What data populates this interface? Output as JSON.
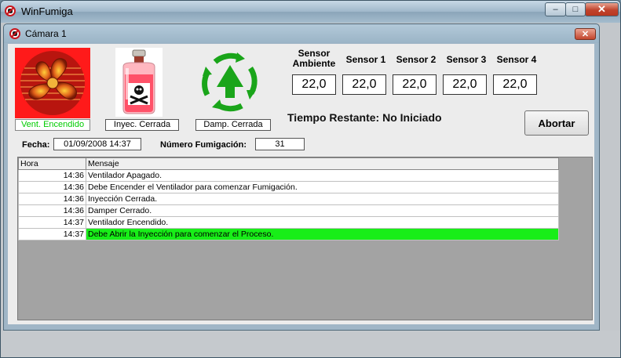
{
  "app": {
    "title": "WinFumiga"
  },
  "window_controls": {
    "minimize": "–",
    "maximize": "□",
    "close": "✕"
  },
  "child": {
    "title": "Cámara 1",
    "close": "✕"
  },
  "status": {
    "fan": "Vent. Encendido",
    "fan_color": "#00cc00",
    "injection": "Inyec. Cerrada",
    "damper": "Damp. Cerrada"
  },
  "sensors": [
    {
      "label": "Sensor\nAmbiente",
      "value": "22,0"
    },
    {
      "label": "Sensor 1",
      "value": "22,0"
    },
    {
      "label": "Sensor 2",
      "value": "22,0"
    },
    {
      "label": "Sensor 3",
      "value": "22,0"
    },
    {
      "label": "Sensor 4",
      "value": "22,0"
    }
  ],
  "tiempo_restante": "Tiempo Restante: No Iniciado",
  "abort_button": "Abortar",
  "fecha": {
    "label": "Fecha:",
    "value": "01/09/2008 14:37"
  },
  "numero": {
    "label": "Número Fumigación:",
    "value": "31"
  },
  "log": {
    "columns": [
      "Hora",
      "Mensaje"
    ],
    "rows": [
      {
        "hora": "14:36",
        "mensaje": "Ventilador Apagado."
      },
      {
        "hora": "14:36",
        "mensaje": "Debe Encender el Ventilador para comenzar Fumigación."
      },
      {
        "hora": "14:36",
        "mensaje": "Inyección Cerrada."
      },
      {
        "hora": "14:36",
        "mensaje": "Damper Cerrado."
      },
      {
        "hora": "14:37",
        "mensaje": "Ventilador Encendido."
      },
      {
        "hora": "14:37",
        "mensaje": "Debe Abrir la Inyección para comenzar el Proceso.",
        "highlight": true
      }
    ],
    "highlight_color": "#18ee18"
  },
  "icons": [
    "app-icon",
    "fan-icon",
    "poison-bottle-icon",
    "recycle-arrows-icon"
  ]
}
